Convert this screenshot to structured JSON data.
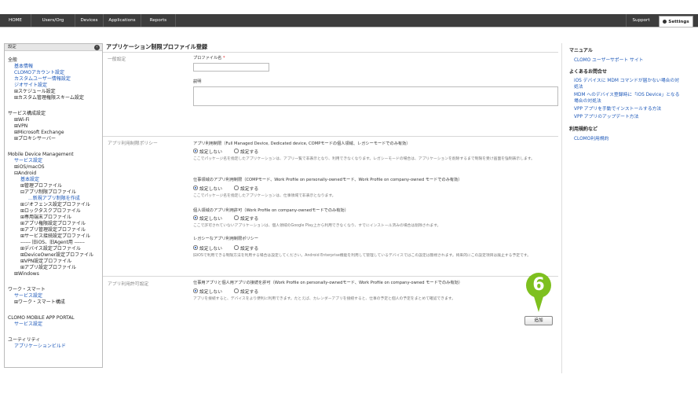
{
  "nav": {
    "home": "HOME",
    "users": "Users/Org",
    "devices": "Devices",
    "applications": "Applications",
    "reports": "Reports",
    "support": "Support",
    "settings": "Settings"
  },
  "sidebar": {
    "header": "設定",
    "general": "全般",
    "basic_info": "基本情報",
    "clomo_account": "CLOMOアカウント設定",
    "custom_user_info": "カスタムユーザー情報設定",
    "geo_settings": "ジオサイト設定",
    "schedule": "スケジュール設定",
    "custom_role": "カスタム管理権限スキーム設定",
    "service_config": "サービス構成設定",
    "wifi": "Wi-Fi",
    "vpn": "VPN",
    "exchange": "Microsoft Exchange",
    "proxy": "プロキシサーバー",
    "mdm": "Mobile Device Management",
    "service_settings": "サービス設定",
    "ios_macos": "iOS/macOS",
    "android": "Android",
    "android_basic": "基本設定",
    "mgmt_profile": "管理プロファイル",
    "app_restrict_profile": "アプリ制限プロファイル",
    "new_app_restrict": "...新規アプリ制限を作成",
    "geofence_profile": "ジオフェンス設定プロファイル",
    "lockdown_profile": "ロックタスクプロファイル",
    "dedicated_profile": "専用端末プロファイル",
    "app_perm_profile": "アプリ権限設定プロファイル",
    "app_mgmt_profile": "アプリ管理設定プロファイル",
    "service_conn_profile": "サービス接続設定プロファイル",
    "old_divider": "------ 旧iOS、旧Agent用 ------",
    "device_profile": "デバイス設定プロファイル",
    "deviceowner_profile": "DeviceOwner設定プロファイル",
    "vpn_profile": "VPN設定プロファイル",
    "app_profile": "アプリ設定プロファイル",
    "windows": "Windows",
    "work_smart": "ワーク・スマート",
    "ws_service": "サービス設定",
    "ws_config": "ワーク・スマート構成",
    "portal": "CLOMO MOBILE APP PORTAL",
    "portal_service": "サービス設定",
    "utility": "ユーティリティ",
    "app_build": "アプリケーションビルド"
  },
  "main": {
    "title": "アプリケーション制限プロファイル登録",
    "general_section": "一般設定",
    "profile_name_label": "プロファイル名",
    "required_mark": "*",
    "description_label": "説明",
    "policy_section": "アプリ利用制限ポリシー",
    "policy1_label": "アプリ利用制限（Full Managed Device, Dedicated device, COMPモードの個人領域、レガシーモードでのみ有効）",
    "policy1_note": "ここでパッケージ名を指定したアプリケーションは、アプリ一覧で非表示となり、利用できなくなります。レガシーモードの場合は、アプリケーションを削除するまで制限を受け画面を強制表示します。",
    "policy2_label": "仕事領域のアプリ利用制限（COMPモード、Work Profile on personally-ownedモード、Work Profile on company-owned モードでのみ有効）",
    "policy2_note": "ここでパッケージ名を指定したアプリケーションは、仕事領域で非表示となります。",
    "policy3_label": "個人領域のアプリ利用許可（Work Profile on company-ownedモードでのみ有効）",
    "policy3_note": "ここで許可されていないアプリケーションは、個人領域のGoogle Play上から利用できなくなり、すでにインストール済みの場合は削除されます。",
    "policy4_label": "レガシーなアプリ利用制限ポリシー",
    "policy4_note": "旧iOSで利用できる制限方法を利用する場合は設定してください。Android Enterprise機能を利用して管理しているデバイスではこの設定は無視されます。将来的にこの設定項目は廃止する予定です。",
    "connect_section": "アプリ利用許可設定",
    "connect_label": "仕事用アプリと個人用アプリの接続を許可（Work Profile on personally-ownedモード、Work Profile on company-owned モードでのみ有効）",
    "connect_note": "アプリを接続すると、デバイスをより便利に利用できます。たとえば、カレンダーアプリを接続すると、仕事の予定と個人の予定をまとめて確認できます。",
    "opt_off": "設定しない",
    "opt_on": "設定する",
    "add_button": "追加",
    "step_number": "6"
  },
  "right": {
    "manual_head": "マニュアル",
    "manual_link": "CLOMO ユーザーサポート サイト",
    "faq_head": "よくあるお問合せ",
    "faq1a": "iOS デバイスに MDM コマンドが届かない場合の対",
    "faq1b": "処法",
    "faq2a": "MDM へのデバイス登録時に「iOS Device」となる",
    "faq2b": "場合の対処法",
    "faq3": "VPP アプリを手動でインストールする方法",
    "faq4": "VPP アプリのアップデート方法",
    "terms_head": "利用規約など",
    "terms_link": "CLOMO利用規約"
  },
  "colors": {
    "topbar": "#3d3d3d",
    "link": "#1a56b8",
    "marker": "#7ec01f",
    "required": "#dd2222"
  }
}
